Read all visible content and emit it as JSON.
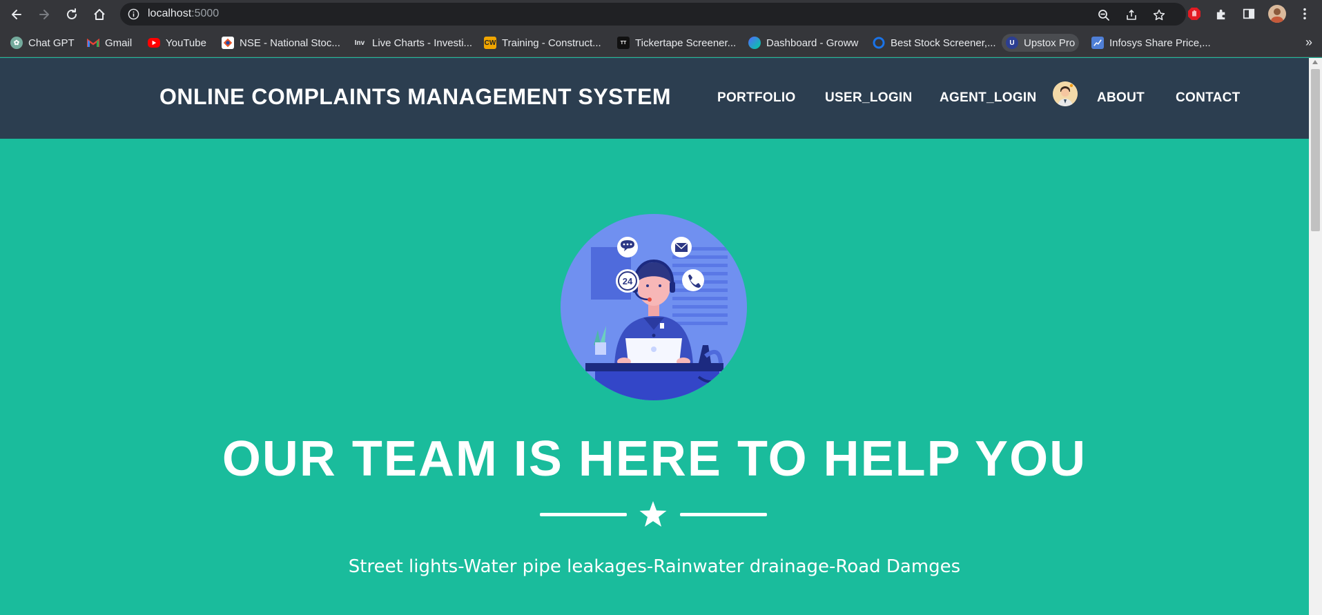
{
  "browser": {
    "url_host": "localhost",
    "url_port": ":5000",
    "bookmarks": [
      {
        "label": "Chat GPT",
        "icon": "chatgpt-icon",
        "color": "#74aa9c"
      },
      {
        "label": "Gmail",
        "icon": "gmail-icon",
        "color": "#ea4335"
      },
      {
        "label": "YouTube",
        "icon": "youtube-icon",
        "color": "#ff0000"
      },
      {
        "label": "NSE - National Stoc...",
        "icon": "nse-icon",
        "color": "#ffffff"
      },
      {
        "label": "Live Charts - Investi...",
        "icon": "investing-icon",
        "color": "#35363a"
      },
      {
        "label": "Training - Construct...",
        "icon": "cw-icon",
        "color": "#f0a500"
      },
      {
        "label": "Tickertape Screener...",
        "icon": "tickertape-icon",
        "color": "#111111"
      },
      {
        "label": "Dashboard - Groww",
        "icon": "groww-icon",
        "color": "#5367ff"
      },
      {
        "label": "Best Stock Screener,...",
        "icon": "screener-icon",
        "color": "#1a73e8"
      },
      {
        "label": "Upstox Pro",
        "icon": "upstox-icon",
        "color": "#2c3e91"
      },
      {
        "label": "Infosys Share Price,...",
        "icon": "infosys-icon",
        "color": "#4f7fd6"
      }
    ],
    "more_bookmarks": "»"
  },
  "site": {
    "brand": "ONLINE COMPLAINTS MANAGEMENT SYSTEM",
    "nav": {
      "portfolio": "PORTFOLIO",
      "user_login": "USER_LOGIN",
      "agent_login": "AGENT_LOGIN",
      "about": "ABOUT",
      "contact": "CONTACT"
    }
  },
  "hero": {
    "title": "OUR TEAM IS HERE TO HELP YOU",
    "subtitle": "Street lights-Water pipe leakages-Rainwater drainage-Road Damges",
    "badge_24": "24"
  },
  "colors": {
    "nav_bg": "#2c3e50",
    "hero_bg": "#1abc9c",
    "text": "#ffffff"
  }
}
